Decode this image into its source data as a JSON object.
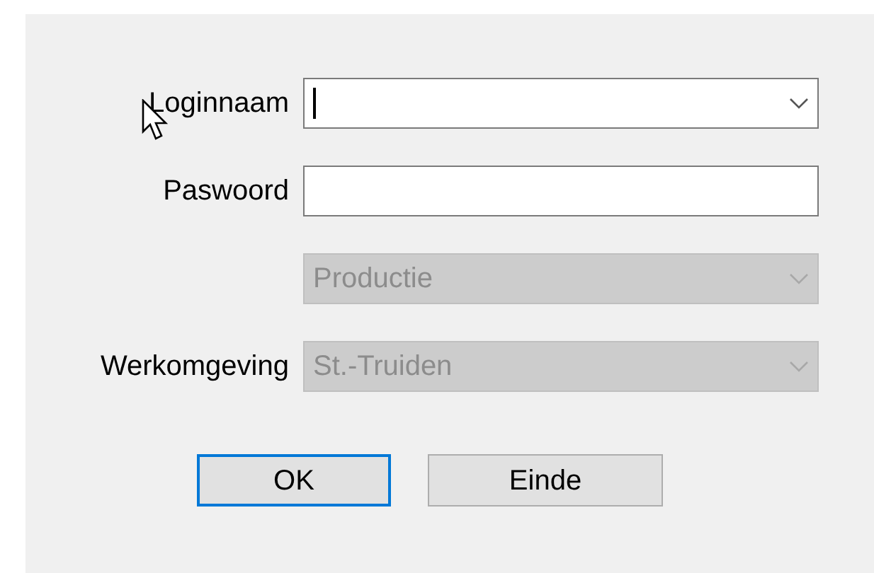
{
  "fields": [
    {
      "label": "Loginnaam",
      "kind": "combo",
      "disabled": false,
      "focused": true
    },
    {
      "label": "Paswoord",
      "kind": "text",
      "disabled": false,
      "focused": false
    },
    {
      "kind": "combo",
      "value": "Productie",
      "disabled": true,
      "focused": false
    },
    {
      "label": "Werkomgeving",
      "kind": "combo",
      "value": "St.-Truiden",
      "disabled": true,
      "focused": false
    }
  ],
  "buttons": [
    {
      "label": "OK",
      "default": true
    },
    {
      "label": "Einde",
      "default": false
    }
  ]
}
